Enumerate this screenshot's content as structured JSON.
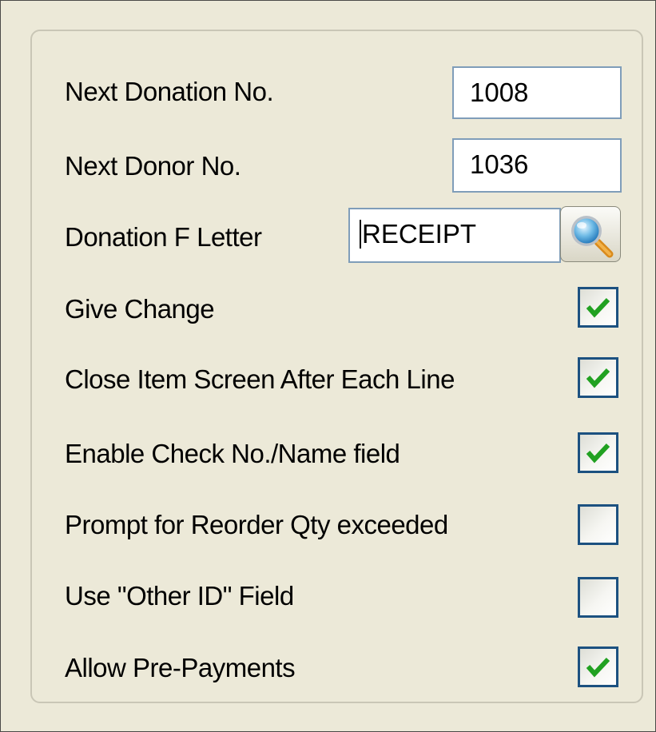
{
  "settings": {
    "next_donation": {
      "label": "Next Donation No.",
      "value": "1008"
    },
    "next_donor": {
      "label": "Next Donor No.",
      "value": "1036"
    },
    "donation_letter": {
      "label": "Donation F Letter",
      "value": "RECEIPT"
    },
    "lookup_icon": "magnifier-icon",
    "checkbox_options": [
      {
        "label": "Give Change",
        "checked": true
      },
      {
        "label": "Close Item Screen After Each Line",
        "checked": true
      },
      {
        "label": "Enable Check No./Name field",
        "checked": true
      },
      {
        "label": "Prompt for Reorder Qty exceeded",
        "checked": false
      },
      {
        "label": "Use \"Other ID\" Field",
        "checked": false
      },
      {
        "label": "Allow Pre-Payments",
        "checked": true
      }
    ]
  },
  "colors": {
    "window_background": "#ECE9D8",
    "textbox_border": "#7F9DB9",
    "checkbox_border": "#1C5180",
    "checkmark": "#21A121"
  }
}
